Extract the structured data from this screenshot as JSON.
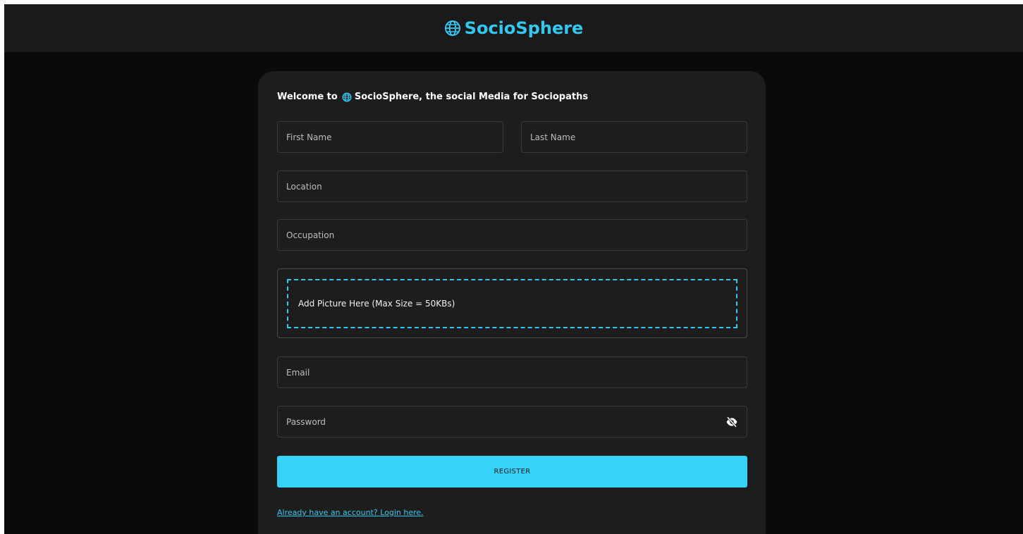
{
  "navbar": {
    "brand_icon": "globe-icon",
    "brand_name": "SocioSphere"
  },
  "form": {
    "welcome_prefix": "Welcome to",
    "welcome_icon": "globe-icon",
    "welcome_suffix": "SocioSphere, the social Media for Sociopaths",
    "first_name_placeholder": "First Name",
    "last_name_placeholder": "Last Name",
    "location_placeholder": "Location",
    "occupation_placeholder": "Occupation",
    "picture_drop_text": "Add Picture Here (Max Size = 50KBs)",
    "email_placeholder": "Email",
    "password_placeholder": "Password",
    "password_toggle_icon": "eye-off-icon",
    "register_label": "REGISTER",
    "login_link_text": "Already have an account? Login here."
  },
  "colors": {
    "accent": "#33c8f2",
    "button": "#36d2f7",
    "background": "#0a0a0a",
    "navbar": "#1a1a1a",
    "card": "#1d1d1d"
  }
}
